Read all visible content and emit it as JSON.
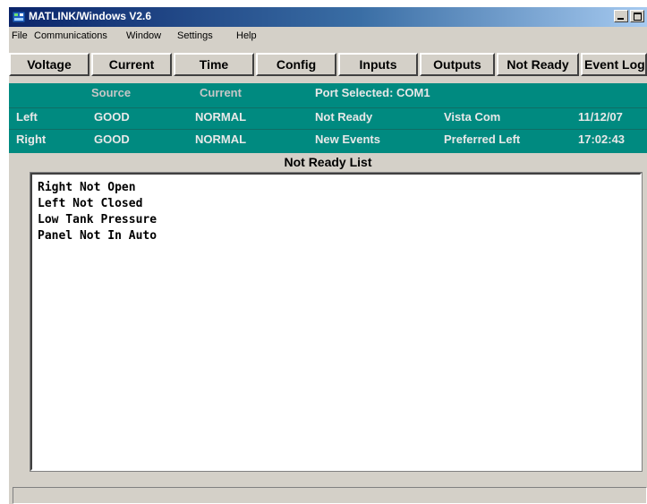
{
  "window": {
    "title": "MATLINK/Windows V2.6"
  },
  "menu": [
    "File",
    "Communications",
    "Window",
    "Settings",
    "Help"
  ],
  "toolbar": [
    "Voltage",
    "Current",
    "Time",
    "Config",
    "Inputs",
    "Outputs",
    "Not Ready",
    "Event Log"
  ],
  "status": {
    "header_source": "Source",
    "header_current": "Current",
    "port_selected": "Port Selected: COM1",
    "left": {
      "label": "Left",
      "source": "GOOD",
      "current": "NORMAL",
      "state": "Not Ready",
      "info": "Vista Com",
      "date": "11/12/07"
    },
    "right": {
      "label": "Right",
      "source": "GOOD",
      "current": "NORMAL",
      "state": "New Events",
      "info": "Preferred Left",
      "time": "17:02:43"
    }
  },
  "list": {
    "title": "Not Ready List",
    "items": [
      "Right Not Open",
      "Left Not Closed",
      "Low Tank Pressure",
      "Panel Not In Auto"
    ]
  },
  "colors": {
    "status_panel": "#008a80",
    "title_bar": "#0a246a"
  }
}
